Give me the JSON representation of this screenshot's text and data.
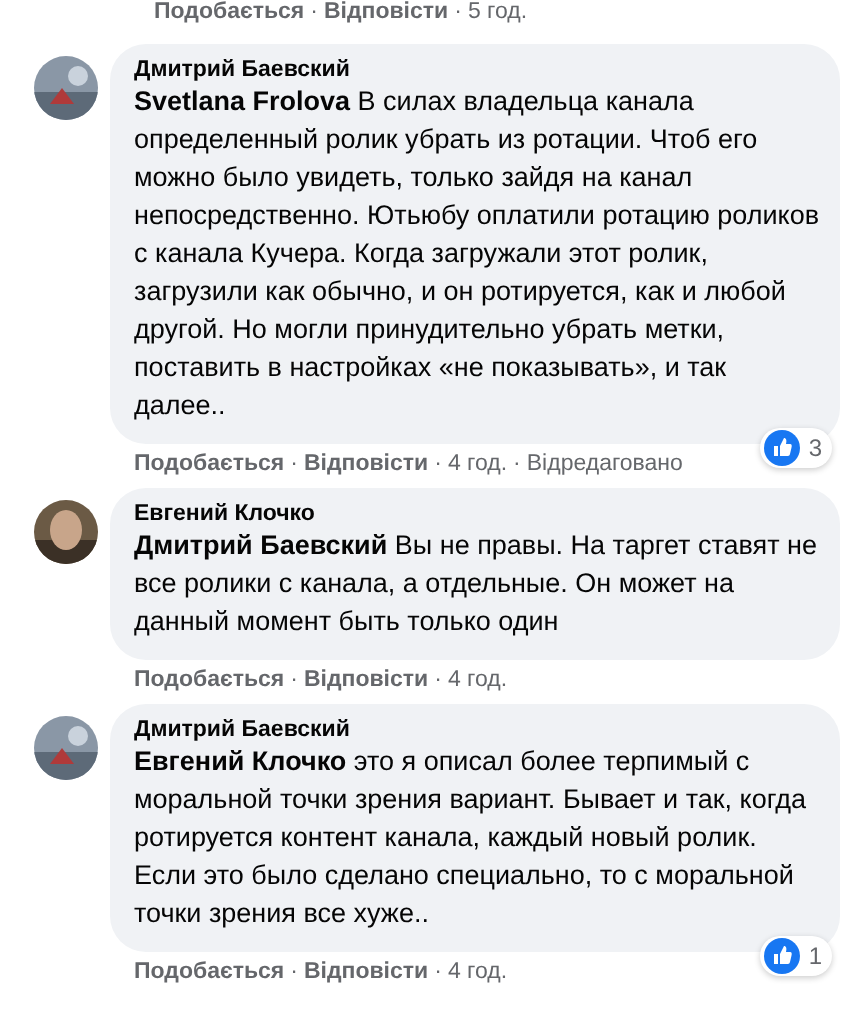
{
  "previous_actions": {
    "actions": [
      {
        "kind": "link",
        "text": "Подобається"
      },
      {
        "kind": "link",
        "text": "Відповісти"
      },
      {
        "kind": "time",
        "text": "5 год."
      }
    ]
  },
  "separator": "·",
  "comments": [
    {
      "author": "Дмитрий Баевский",
      "avatar": {
        "kind": "picture"
      },
      "text": "**Svetlana Frolova** В силах владельца канала определенный ролик убрать из ротации. Чтоб его можно было увидеть, только зайдя на канал непосредственно. Ютьюбу оплатили ротацию роликов с канала Кучера. Когда загружали этот ролик, загрузили как обычно, и он ротируется, как и любой другой. Но могли принудительно убрать метки, поставить в настройках «не показывать», и так далее..",
      "reactions": {
        "count": "3"
      },
      "actions": [
        {
          "kind": "link",
          "text": "Подобається"
        },
        {
          "kind": "link",
          "text": "Відповісти"
        },
        {
          "kind": "time",
          "text": "4 год."
        },
        {
          "kind": "note",
          "text": "Відредаговано"
        }
      ]
    },
    {
      "author": "Евгений Клочко",
      "avatar": {
        "kind": "picture"
      },
      "text": "**Дмитрий Баевский** Вы не правы. На таргет ставят не все ролики с канала, а отдельные. Он может на данный момент быть только один",
      "actions": [
        {
          "kind": "link",
          "text": "Подобається"
        },
        {
          "kind": "link",
          "text": "Відповісти"
        },
        {
          "kind": "time",
          "text": "4 год."
        }
      ]
    },
    {
      "author": "Дмитрий Баевский",
      "avatar": {
        "kind": "picture"
      },
      "text": "**Евгений Клочко** это я описал более терпимый с моральной точки зрения вариант. Бывает и так, когда ротируется контент канала, каждый новый ролик.\nЕсли это было сделано специально, то с моральной точки зрения все хуже..",
      "reactions": {
        "count": "1"
      },
      "actions": [
        {
          "kind": "link",
          "text": "Подобається"
        },
        {
          "kind": "link",
          "text": "Відповісти"
        },
        {
          "kind": "time",
          "text": "4 год."
        }
      ]
    }
  ]
}
